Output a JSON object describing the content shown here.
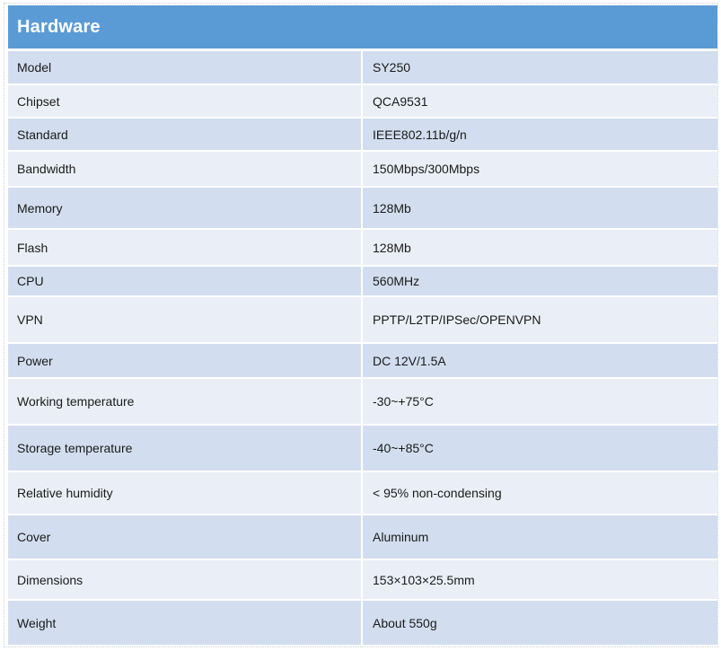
{
  "header": {
    "title": "Hardware"
  },
  "rows": [
    {
      "label": "Model",
      "value": "SY250"
    },
    {
      "label": "Chipset",
      "value": "QCA9531"
    },
    {
      "label": "Standard",
      "value": "IEEE802.11b/g/n"
    },
    {
      "label": "Bandwidth",
      "value": "150Mbps/300Mbps"
    },
    {
      "label": "Memory",
      "value": "128Mb"
    },
    {
      "label": "Flash",
      "value": "128Mb"
    },
    {
      "label": "CPU",
      "value": "560MHz"
    },
    {
      "label": "VPN",
      "value": "PPTP/L2TP/IPSec/OPENVPN"
    },
    {
      "label": "Power",
      "value": "DC 12V/1.5A"
    },
    {
      "label": "Working temperature",
      "value": "-30~+75°C"
    },
    {
      "label": "Storage temperature",
      "value": "-40~+85°C"
    },
    {
      "label": "Relative humidity",
      "value": "< 95% non-condensing"
    },
    {
      "label": "Cover",
      "value": "Aluminum"
    },
    {
      "label": "Dimensions",
      "value": "153×103×25.5mm"
    },
    {
      "label": "Weight",
      "value": "About 550g"
    }
  ],
  "colors": {
    "header_background": "#5b9bd5",
    "row_shade_dark": "#d2deef",
    "row_shade_light": "#eaeff7"
  }
}
